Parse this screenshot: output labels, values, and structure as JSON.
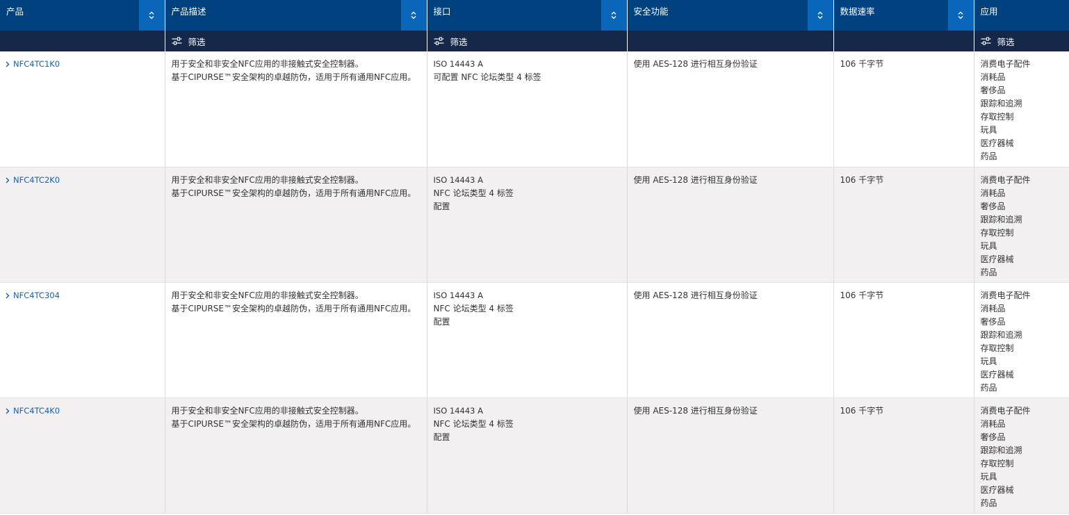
{
  "columns": [
    {
      "label": "产品",
      "filter": false
    },
    {
      "label": "产品描述",
      "filter": true
    },
    {
      "label": "接口",
      "filter": true
    },
    {
      "label": "安全功能",
      "filter": false
    },
    {
      "label": "数据速率",
      "filter": false
    },
    {
      "label": "应用",
      "filter": true
    }
  ],
  "filter_label": "筛选",
  "rows": [
    {
      "product": "NFC4TC1K0",
      "description": [
        "用于安全和非安全NFC应用的非接触式安全控制器。",
        "基于CIPURSE™安全架构的卓越防伪，适用于所有通用NFC应用。"
      ],
      "interface": [
        "ISO 14443 A",
        "可配置 NFC 论坛类型 4 标签"
      ],
      "security": "使用 AES-128 进行相互身份验证",
      "data_rate": "106 千字节",
      "applications": [
        "消费电子配件",
        "消耗品",
        "奢侈品",
        "跟踪和追溯",
        "存取控制",
        "玩具",
        "医疗器械",
        "药品"
      ]
    },
    {
      "product": "NFC4TC2K0",
      "description": [
        "用于安全和非安全NFC应用的非接触式安全控制器。",
        "基于CIPURSE™安全架构的卓越防伪，适用于所有通用NFC应用。"
      ],
      "interface": [
        "ISO 14443 A",
        "NFC 论坛类型 4 标签",
        "配置"
      ],
      "security": "使用 AES-128 进行相互身份验证",
      "data_rate": "106 千字节",
      "applications": [
        "消费电子配件",
        "消耗品",
        "奢侈品",
        "跟踪和追溯",
        "存取控制",
        "玩具",
        "医疗器械",
        "药品"
      ]
    },
    {
      "product": "NFC4TC304",
      "description": [
        "用于安全和非安全NFC应用的非接触式安全控制器。",
        "基于CIPURSE™安全架构的卓越防伪，适用于所有通用NFC应用。"
      ],
      "interface": [
        "ISO 14443 A",
        "NFC 论坛类型 4 标签",
        "配置"
      ],
      "security": "使用 AES-128 进行相互身份验证",
      "data_rate": "106 千字节",
      "applications": [
        "消费电子配件",
        "消耗品",
        "奢侈品",
        "跟踪和追溯",
        "存取控制",
        "玩具",
        "医疗器械",
        "药品"
      ]
    },
    {
      "product": "NFC4TC4K0",
      "description": [
        "用于安全和非安全NFC应用的非接触式安全控制器。",
        "基于CIPURSE™安全架构的卓越防伪，适用于所有通用NFC应用。"
      ],
      "interface": [
        "ISO 14443 A",
        "NFC 论坛类型 4 标签",
        "配置"
      ],
      "security": "使用 AES-128 进行相互身份验证",
      "data_rate": "106 千字节",
      "applications": [
        "消费电子配件",
        "消耗品",
        "奢侈品",
        "跟踪和追溯",
        "存取控制",
        "玩具",
        "医疗器械",
        "药品"
      ]
    }
  ],
  "icons": {
    "sort": "sort-up-down-icon",
    "filter": "sliders-icon",
    "row_expand": "chevron-right-icon"
  },
  "colors": {
    "header_bg": "#00417f",
    "sort_btn_bg": "#0a66b8",
    "filter_row_bg": "#152849",
    "link": "#1762ab",
    "alt_row_bg": "#f2f0f1"
  }
}
